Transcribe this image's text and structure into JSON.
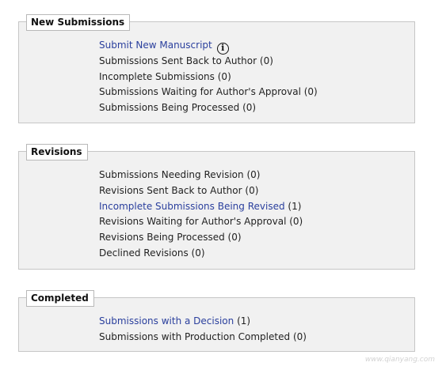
{
  "sections": {
    "new_submissions": {
      "title": "New Submissions",
      "items": [
        {
          "label": "Submit New Manuscript",
          "count": ""
        },
        {
          "label": "Submissions Sent Back to Author",
          "count": "(0)"
        },
        {
          "label": "Incomplete Submissions",
          "count": "(0)"
        },
        {
          "label": "Submissions Waiting for Author's Approval",
          "count": "(0)"
        },
        {
          "label": "Submissions Being Processed",
          "count": "(0)"
        }
      ],
      "info_icon_glyph": "i"
    },
    "revisions": {
      "title": "Revisions",
      "items": [
        {
          "label": "Submissions Needing Revision",
          "count": "(0)"
        },
        {
          "label": "Revisions Sent Back to Author",
          "count": "(0)"
        },
        {
          "label": "Incomplete Submissions Being Revised",
          "count": "(1)"
        },
        {
          "label": "Revisions Waiting for Author's Approval",
          "count": "(0)"
        },
        {
          "label": "Revisions Being Processed",
          "count": " (0)"
        },
        {
          "label": "Declined Revisions",
          "count": "(0)"
        }
      ]
    },
    "completed": {
      "title": "Completed",
      "items": [
        {
          "label": "Submissions with a Decision",
          "count": "(1)"
        },
        {
          "label": "Submissions with Production Completed",
          "count": "(0)"
        }
      ]
    }
  },
  "watermark": "www.qianyang.com",
  "colors": {
    "link": "#2a3f9d",
    "panel_bg": "#f1f1f1",
    "panel_border": "#c6c6c6"
  },
  "icons": {
    "info": "info-circle-icon"
  }
}
